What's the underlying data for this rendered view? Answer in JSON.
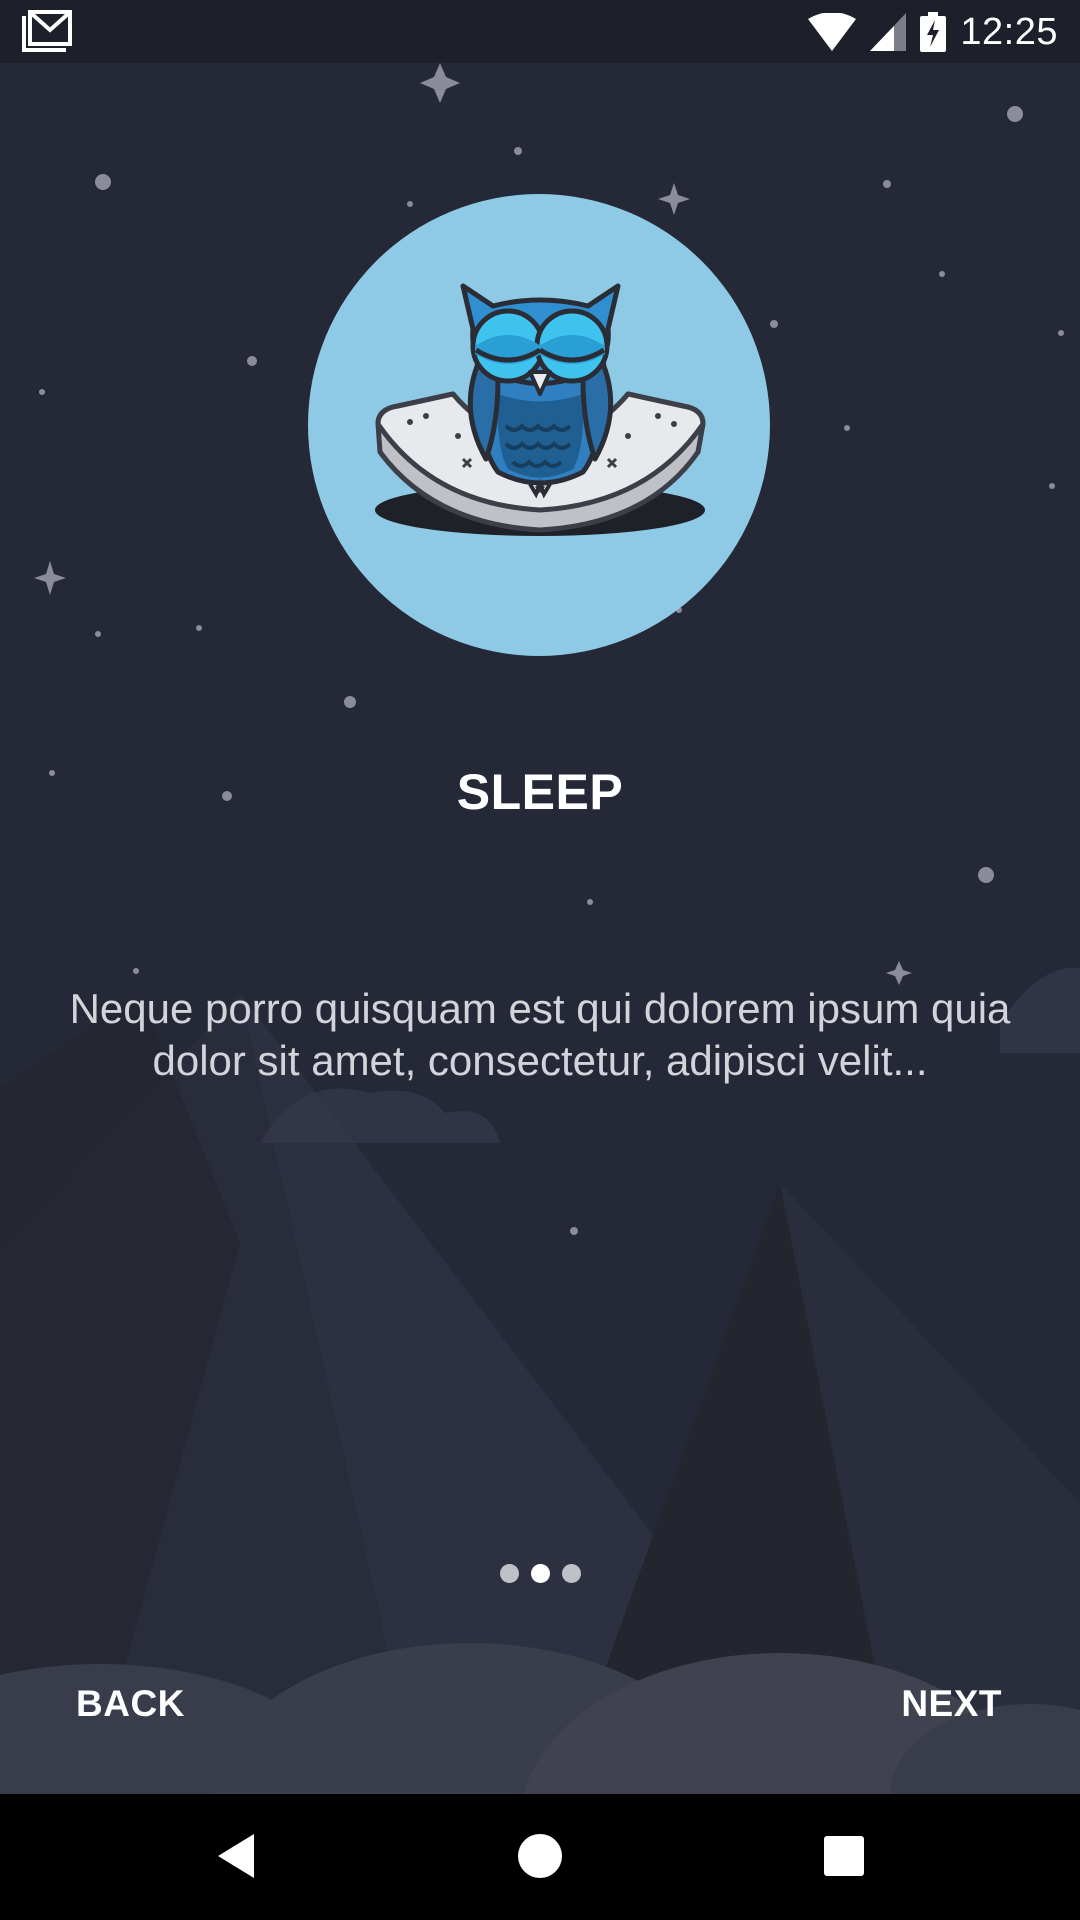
{
  "status_bar": {
    "time": "12:25",
    "icons": [
      "gmail-notification-icon",
      "wifi-icon",
      "cell-signal-icon",
      "battery-charging-icon"
    ]
  },
  "onboarding": {
    "title": "SLEEP",
    "description": "Neque porro quisquam est qui dolorem ipsum quia dolor sit amet, consectetur, adipisci velit...",
    "page_count": 3,
    "active_page": 2,
    "back_label": "BACK",
    "next_label": "NEXT",
    "hero_icon": "sleeping-owl-on-mattress-icon"
  },
  "colors": {
    "background": "#252837",
    "hero_circle": "#8ecae5",
    "owl": "#2f8fd0"
  },
  "nav_bar": {
    "buttons": [
      "back-triangle-icon",
      "home-circle-icon",
      "recents-square-icon"
    ]
  }
}
